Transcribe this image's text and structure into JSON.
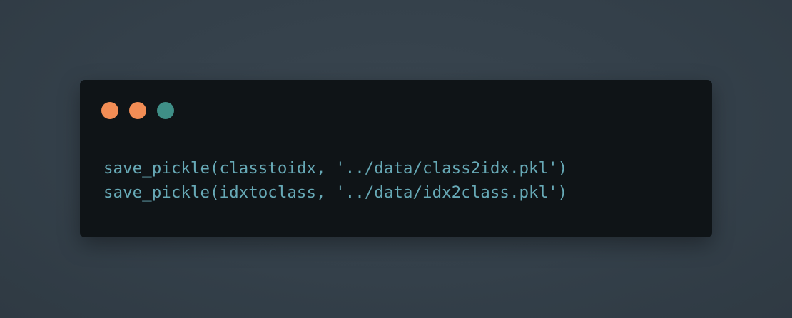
{
  "window": {
    "controls": [
      {
        "name": "close-dot",
        "color": "#f28d55"
      },
      {
        "name": "minimize-dot",
        "color": "#f28d55"
      },
      {
        "name": "maximize-dot",
        "color": "#3f8f87"
      }
    ]
  },
  "code": {
    "lines": [
      "save_pickle(classtoidx, '../data/class2idx.pkl')",
      "save_pickle(idxtoclass, '../data/idx2class.pkl')"
    ],
    "color": "#67a9b6"
  }
}
